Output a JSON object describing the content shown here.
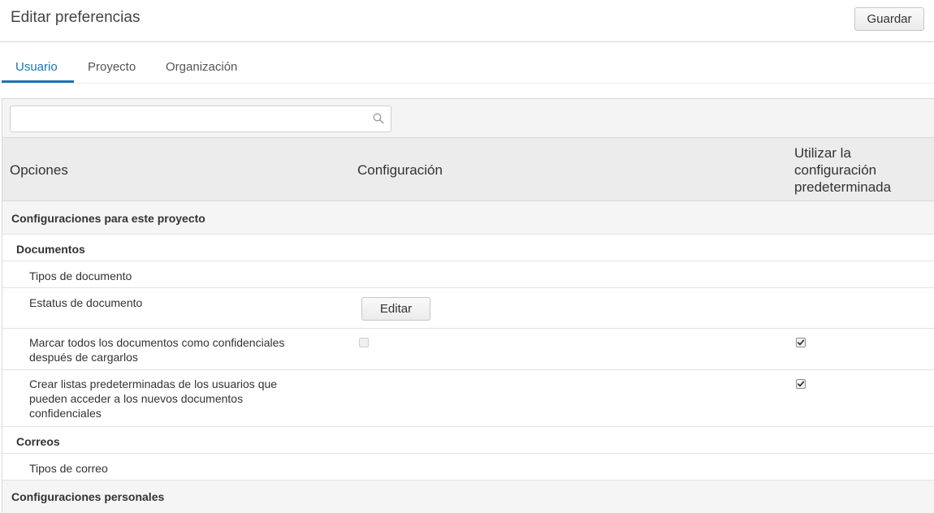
{
  "header": {
    "title": "Editar preferencias",
    "save_label": "Guardar"
  },
  "tabs": [
    {
      "label": "Usuario",
      "active": true
    },
    {
      "label": "Proyecto",
      "active": false
    },
    {
      "label": "Organización",
      "active": false
    }
  ],
  "search": {
    "value": "",
    "placeholder": ""
  },
  "table": {
    "columns": [
      "Opciones",
      "Configuración",
      "Utilizar la configuración predeterminada"
    ],
    "col3_lines": [
      "Utilizar la",
      "configuración",
      "predeterminada"
    ]
  },
  "rows": {
    "section_project": "Configuraciones para este proyecto",
    "group_documents": "Documentos",
    "doc_types": "Tipos de documento",
    "doc_status": "Estatus de documento",
    "doc_status_button": "Editar",
    "mark_confidential_line1": "Marcar todos los documentos como confidenciales",
    "mark_confidential_line2": "después de cargarlos",
    "mark_confidential_setting_checked": false,
    "mark_confidential_default_checked": true,
    "default_lists_line1": "Crear listas predeterminadas de los usuarios que",
    "default_lists_line2": "pueden acceder a los nuevos documentos",
    "default_lists_line3": "confidenciales",
    "default_lists_default_checked": true,
    "group_mail": "Correos",
    "mail_types": "Tipos de correo",
    "section_personal": "Configuraciones personales"
  },
  "colors": {
    "accent": "#1a73b8"
  }
}
